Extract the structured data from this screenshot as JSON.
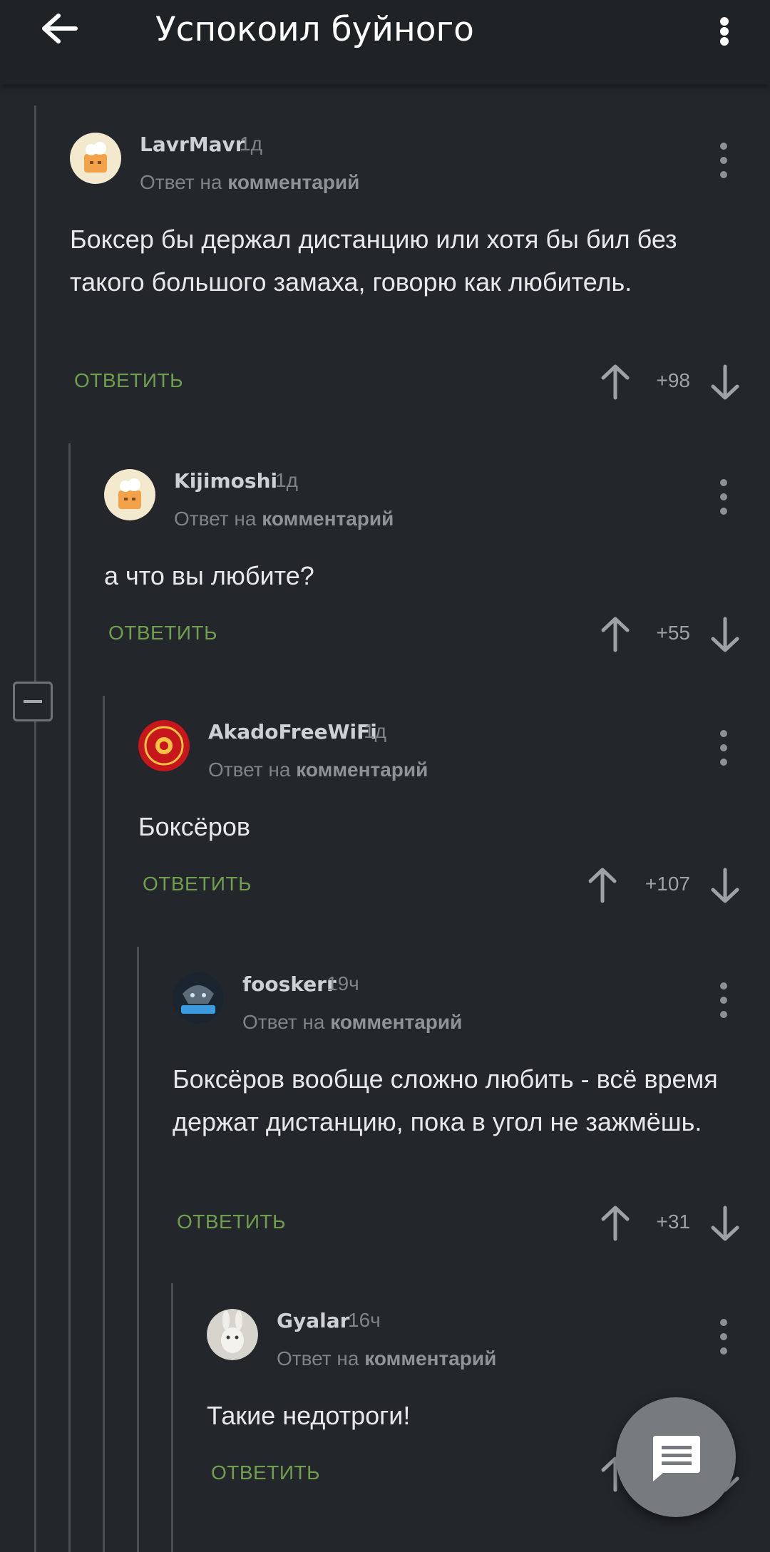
{
  "header": {
    "title": "Успокоил буйного",
    "back_icon": "arrow-left-icon",
    "menu_icon": "more-vertical-icon"
  },
  "colors": {
    "background": "#23272b",
    "header": "#202326",
    "accent_green": "#6f9e4f",
    "thread_line": "#4a4e53"
  },
  "comments": [
    {
      "username": "LavrMavr",
      "time": "1д",
      "reply_prefix": "Ответ на",
      "reply_target": "комментарий",
      "text": "Боксер бы держал дистанцию или хотя бы бил без такого большого замаха, говорю как любитель.",
      "reply_label": "ОТВЕТИТЬ",
      "score": "+98"
    },
    {
      "username": "Kijimoshi",
      "time": "1д",
      "reply_prefix": "Ответ на",
      "reply_target": "комментарий",
      "text": "а что вы любите?",
      "reply_label": "ОТВЕТИТЬ",
      "score": "+55"
    },
    {
      "username": "AkadoFreeWiFi",
      "time": "1д",
      "reply_prefix": "Ответ на",
      "reply_target": "комментарий",
      "text": "Боксёров",
      "reply_label": "ОТВЕТИТЬ",
      "score": "+107"
    },
    {
      "username": "fooskerr",
      "time": "19ч",
      "reply_prefix": "Ответ на",
      "reply_target": "комментарий",
      "text": "Боксёров вообще сложно любить - всё время держат дистанцию, пока в угол не зажмёшь.",
      "reply_label": "ОТВЕТИТЬ",
      "score": "+31"
    },
    {
      "username": "Gyalar",
      "time": "16ч",
      "reply_prefix": "Ответ на",
      "reply_target": "комментарий",
      "text": "Такие недотроги!",
      "reply_label": "ОТВЕТИТЬ",
      "score": ""
    }
  ],
  "fab": {
    "icon": "comment-icon"
  }
}
